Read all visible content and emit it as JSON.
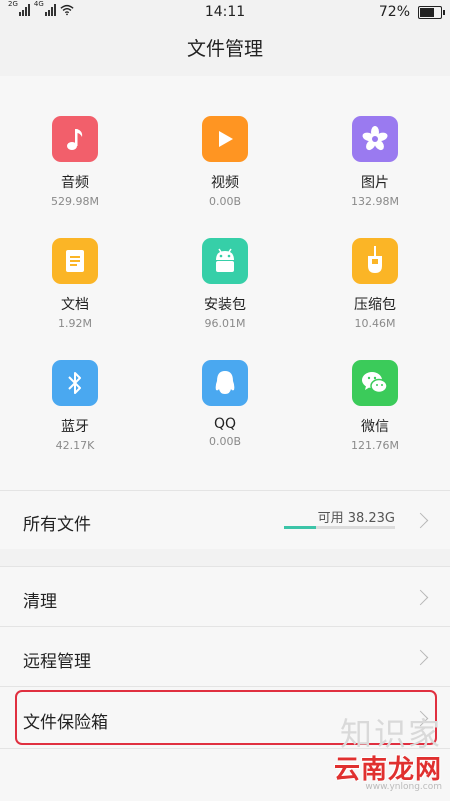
{
  "status": {
    "net1": "2G",
    "net2": "4G",
    "time": "14:11",
    "battery": "72%",
    "battery_level": 0.72
  },
  "title": "文件管理",
  "categories": [
    {
      "name": "音频",
      "size": "529.98M",
      "icon": "music-note-icon",
      "color": "#f25f6b"
    },
    {
      "name": "视频",
      "size": "0.00B",
      "icon": "play-icon",
      "color": "#ff9522"
    },
    {
      "name": "图片",
      "size": "132.98M",
      "icon": "flower-icon",
      "color": "#9a7af0"
    },
    {
      "name": "文档",
      "size": "1.92M",
      "icon": "document-icon",
      "color": "#fbb526"
    },
    {
      "name": "安装包",
      "size": "96.01M",
      "icon": "android-icon",
      "color": "#36cfa8"
    },
    {
      "name": "压缩包",
      "size": "10.46M",
      "icon": "zip-icon",
      "color": "#fbb526"
    },
    {
      "name": "蓝牙",
      "size": "42.17K",
      "icon": "bluetooth-icon",
      "color": "#4aa8f0"
    },
    {
      "name": "QQ",
      "size": "0.00B",
      "icon": "qq-penguin-icon",
      "color": "#4aa8f0"
    },
    {
      "name": "微信",
      "size": "121.76M",
      "icon": "wechat-icon",
      "color": "#3bcb5a"
    }
  ],
  "all_files": {
    "label": "所有文件",
    "available": "可用 38.23G",
    "used_fraction": 0.29,
    "bar_color": "#3cc4a8"
  },
  "menu": [
    {
      "label": "清理"
    },
    {
      "label": "远程管理"
    },
    {
      "label": "文件保险箱"
    }
  ],
  "watermark": {
    "line1": "知识家",
    "line2": "云南龙网",
    "line3": "www.ynlong.com"
  }
}
